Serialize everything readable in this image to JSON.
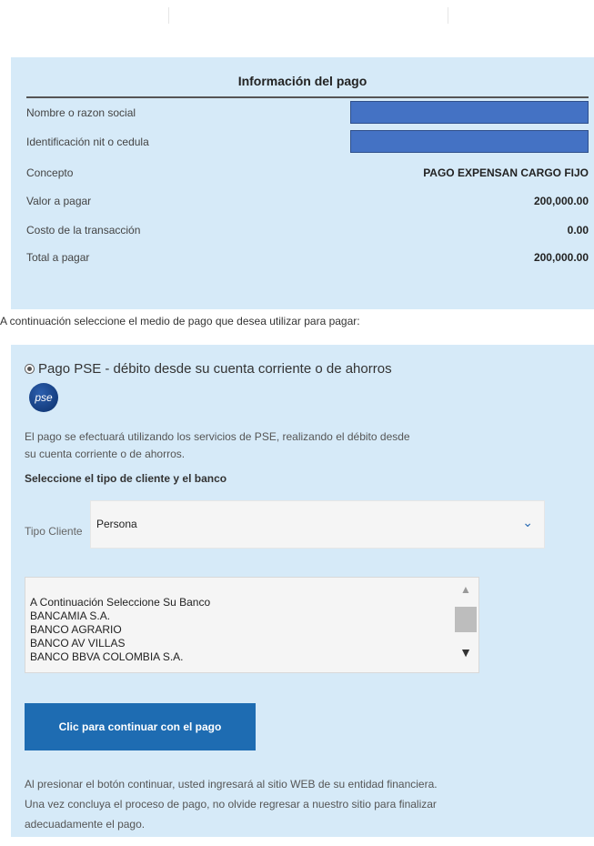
{
  "payment_info": {
    "title": "Información del pago",
    "rows": [
      {
        "label": "Nombre o razon social",
        "value": ""
      },
      {
        "label": "Identificación nit o cedula",
        "value": ""
      },
      {
        "label": "Concepto",
        "value": "PAGO EXPENSAN CARGO FIJO"
      },
      {
        "label": "Valor a pagar",
        "value": "200,000.00"
      },
      {
        "label": "Costo de la transacción",
        "value": "0.00"
      },
      {
        "label": "Total a pagar",
        "value": "200,000.00"
      }
    ]
  },
  "instructions": "A continuación seleccione el medio de pago que desea utilizar para pagar:",
  "pse_section": {
    "option_label": "Pago PSE - débito desde su cuenta corriente o de ahorros",
    "logo_text": "pse",
    "desc_line1": "El pago se efectuará utilizando los servicios de PSE, realizando el débito desde",
    "desc_line2": "su cuenta corriente o de ahorros.",
    "select_title": "Seleccione el tipo de cliente y el banco",
    "tipo_cliente_label": "Tipo Cliente",
    "tipo_cliente_value": "Persona",
    "banks": [
      "A Continuación Seleccione Su Banco",
      "BANCAMIA S.A.",
      "BANCO AGRARIO",
      "BANCO AV VILLAS",
      "BANCO BBVA COLOMBIA S.A."
    ],
    "continue_button": "Clic para continuar con el pago",
    "footer_line1": "Al presionar el botón continuar, usted ingresará al sitio WEB de su entidad financiera.",
    "footer_line2": "Una vez concluya el proceso de pago, no olvide regresar a nuestro sitio para finalizar",
    "footer_line3": "adecuadamente el pago."
  },
  "colors": {
    "panel_bg": "#d6eaf8",
    "redact": "#4472c4",
    "button": "#1e6cb2"
  }
}
